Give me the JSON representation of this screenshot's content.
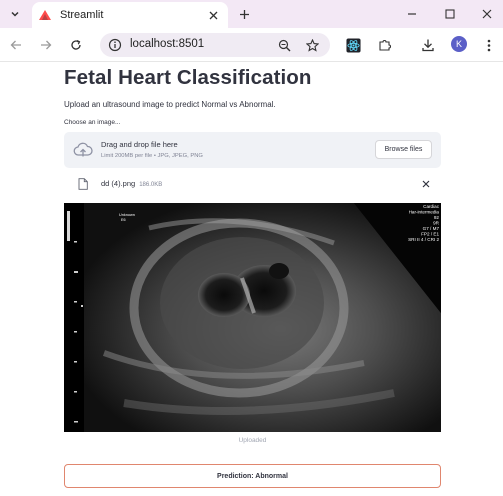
{
  "browser": {
    "tab_title": "Streamlit",
    "url": "localhost:8501",
    "profile_initial": "K"
  },
  "page": {
    "title": "Fetal Heart Classification",
    "description": "Upload an ultrasound image to predict Normal vs Abnormal."
  },
  "uploader": {
    "label": "Choose an image...",
    "drop_title": "Drag and drop file here",
    "limit_text": "Limit 200MB per file • JPG, JPEG, PNG",
    "browse_label": "Browse files"
  },
  "file": {
    "name": "dd (4).png",
    "size": "186.0KB"
  },
  "image": {
    "caption": "Uploaded",
    "overlay_left": [
      "Unknown",
      "E6"
    ],
    "overlay_right": [
      "Cardiac",
      "Har-intermedia",
      "92",
      "9R",
      "G7 / M7",
      "FP2 / E1",
      "SRI II 4 / CRI 2"
    ]
  },
  "result": {
    "prediction": "Prediction: Abnormal"
  },
  "colors": {
    "tabbar": "#f3e8f5",
    "accent": "#5b5fc7",
    "text": "#31333f",
    "prediction_border": "#e0866e"
  }
}
